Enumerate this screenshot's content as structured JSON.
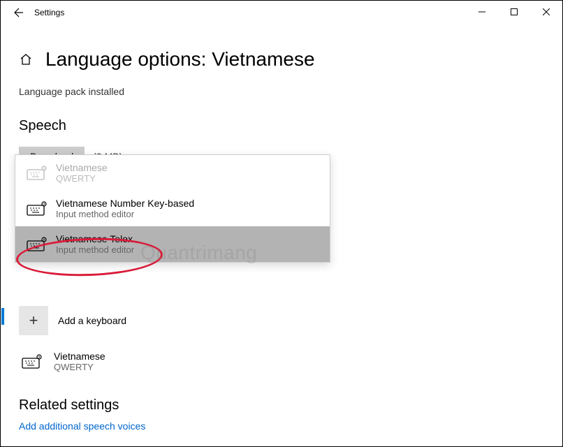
{
  "window": {
    "title": "Settings"
  },
  "page": {
    "title": "Language options: Vietnamese",
    "status": "Language pack installed"
  },
  "speech": {
    "heading": "Speech",
    "download_label": "Download",
    "download_size": "(3 MB)"
  },
  "dropdown": {
    "items": [
      {
        "label": "Vietnamese",
        "sub": "QWERTY",
        "state": "disabled"
      },
      {
        "label": "Vietnamese Number Key-based",
        "sub": "Input method editor",
        "state": "normal"
      },
      {
        "label": "Vietnamese Telex",
        "sub": "Input method editor",
        "state": "selected"
      }
    ]
  },
  "add_keyboard": {
    "label": "Add a keyboard"
  },
  "current_keyboard": {
    "label": "Vietnamese",
    "sub": "QWERTY"
  },
  "related": {
    "heading": "Related settings",
    "link": "Add additional speech voices"
  },
  "watermark": "Quantrimang"
}
